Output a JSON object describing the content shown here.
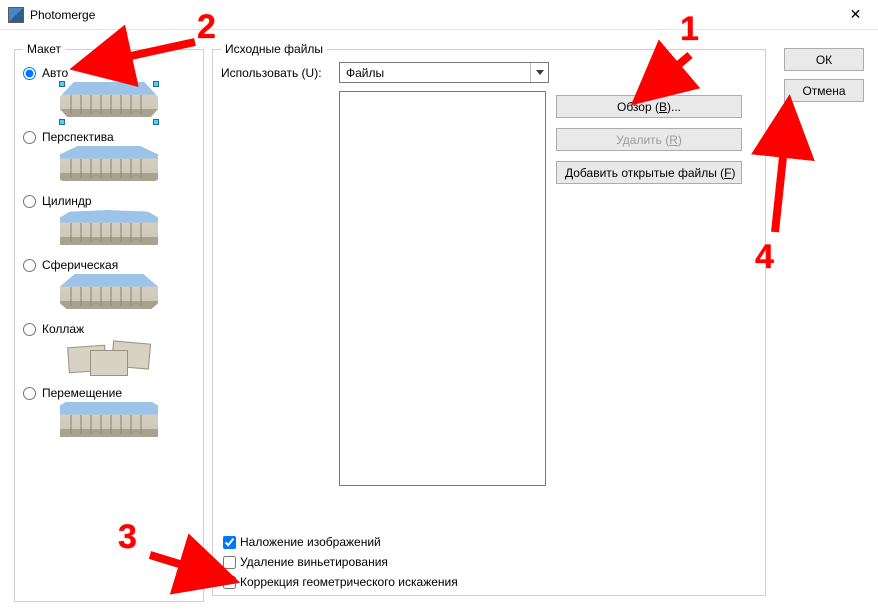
{
  "title": "Photomerge",
  "layout": {
    "legend": "Макет",
    "options": [
      {
        "label": "Авто",
        "selected": true
      },
      {
        "label": "Перспектива",
        "selected": false
      },
      {
        "label": "Цилиндр",
        "selected": false
      },
      {
        "label": "Сферическая",
        "selected": false
      },
      {
        "label": "Коллаж",
        "selected": false
      },
      {
        "label": "Перемещение",
        "selected": false
      }
    ]
  },
  "source": {
    "legend": "Исходные файлы",
    "use_label": "Использовать (U):",
    "use_value": "Файлы",
    "buttons": {
      "browse_pre": "Обзор (",
      "browse_key": "B",
      "browse_post": ")...",
      "remove_pre": "Удалить (",
      "remove_key": "R",
      "remove_post": ")",
      "addopen_pre": "Добавить открытые файлы (",
      "addopen_key": "F",
      "addopen_post": ")"
    },
    "checks": {
      "blend": {
        "label": "Наложение изображений",
        "checked": true
      },
      "vignette": {
        "label": "Удаление виньетирования",
        "checked": false
      },
      "geom": {
        "label": "Коррекция геометрического искажения",
        "checked": false
      }
    }
  },
  "actions": {
    "ok": "ОК",
    "cancel": "Отмена"
  },
  "annotations": {
    "n1": "1",
    "n2": "2",
    "n3": "3",
    "n4": "4"
  }
}
